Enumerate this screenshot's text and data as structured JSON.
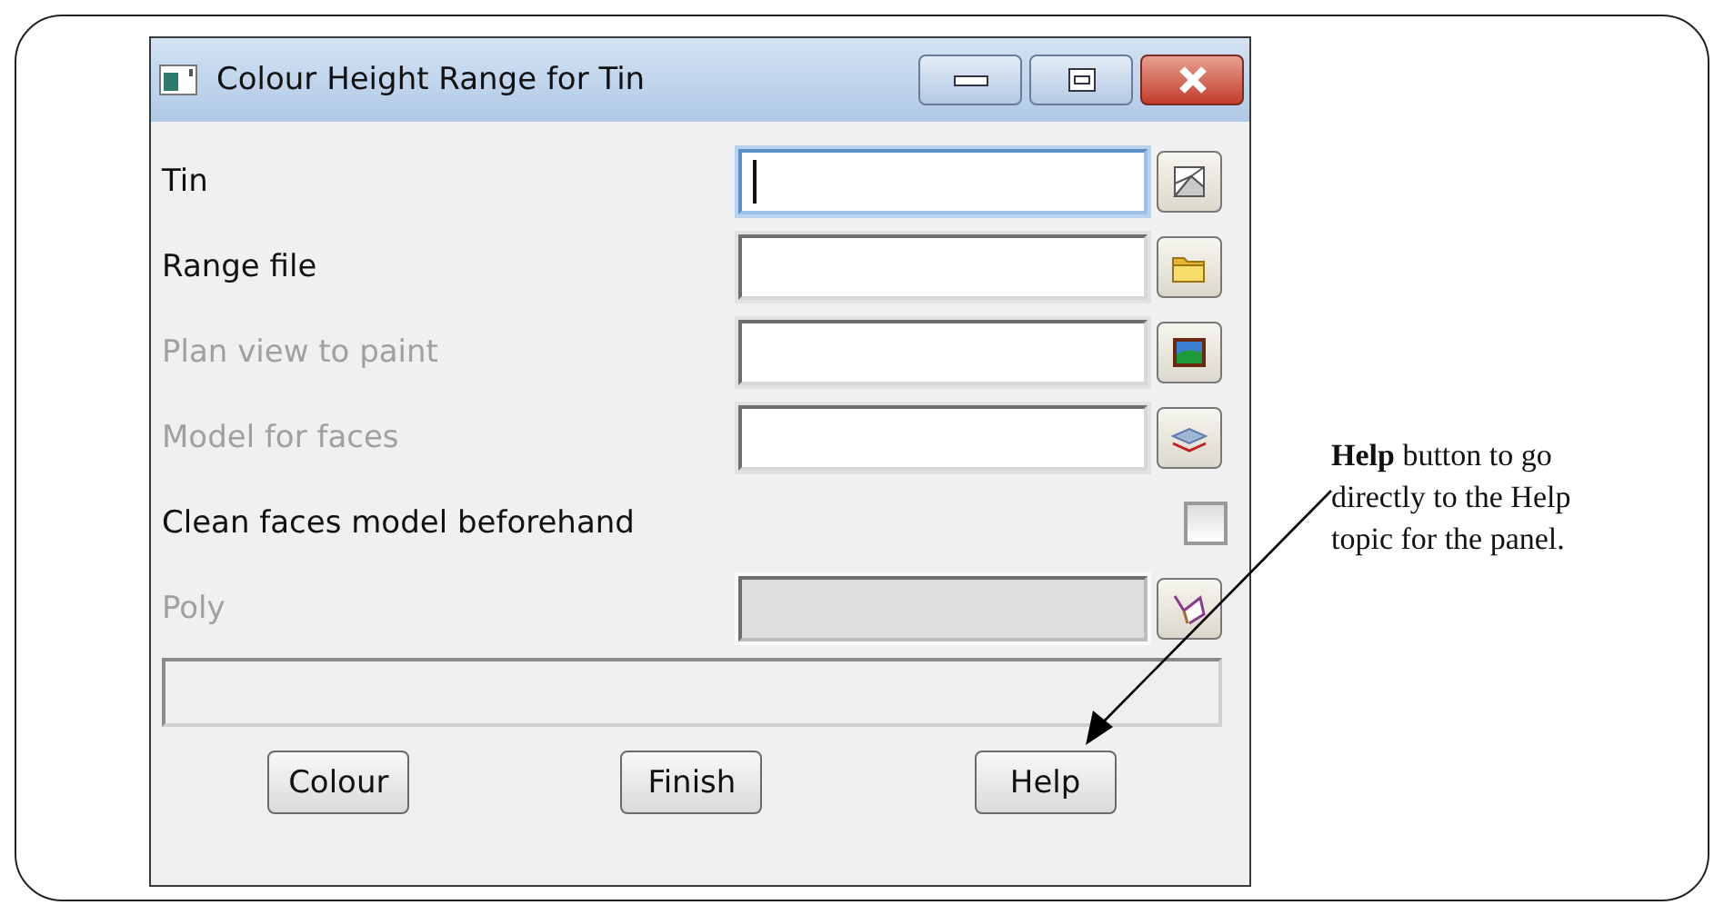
{
  "window": {
    "title": "Colour Height Range for Tin"
  },
  "rows": [
    {
      "kind": "field",
      "label": "Tin",
      "disabled": false,
      "focused": true,
      "read_only": false
    },
    {
      "kind": "field",
      "label": "Range file",
      "disabled": false,
      "focused": false,
      "read_only": false
    },
    {
      "kind": "field",
      "label": "Plan view to paint",
      "disabled": true,
      "focused": false,
      "read_only": false
    },
    {
      "kind": "field",
      "label": "Model for faces",
      "disabled": true,
      "focused": false,
      "read_only": false
    },
    {
      "kind": "checkbox",
      "label": "Clean faces model beforehand",
      "disabled": false,
      "checked": false
    },
    {
      "kind": "field",
      "label": "Poly",
      "disabled": true,
      "focused": false,
      "read_only": true
    }
  ],
  "buttons": [
    "Colour",
    "Finish",
    "Help"
  ],
  "annotation": "**Help** button to go directly to the Help topic for the panel."
}
